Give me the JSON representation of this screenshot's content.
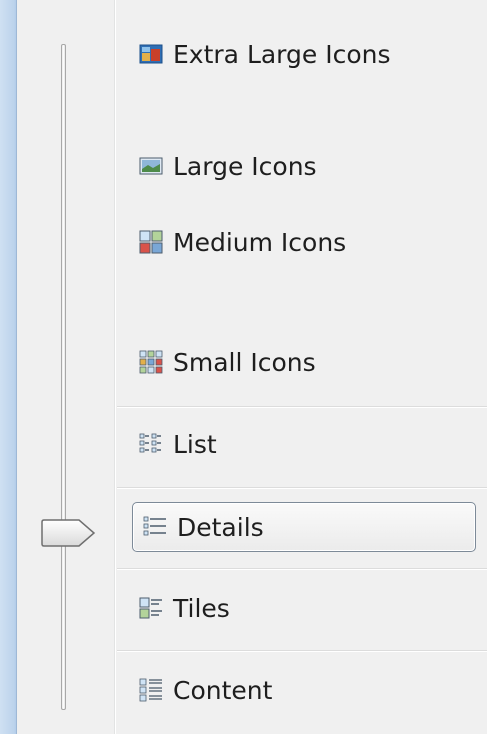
{
  "view_menu": {
    "items": [
      {
        "label": "Extra Large Icons",
        "icon": "extra-large-icons-icon"
      },
      {
        "label": "Large Icons",
        "icon": "large-icons-icon"
      },
      {
        "label": "Medium Icons",
        "icon": "medium-icons-icon"
      },
      {
        "label": "Small Icons",
        "icon": "small-icons-icon"
      },
      {
        "label": "List",
        "icon": "list-icon"
      },
      {
        "label": "Details",
        "icon": "details-icon"
      },
      {
        "label": "Tiles",
        "icon": "tiles-icon"
      },
      {
        "label": "Content",
        "icon": "content-icon"
      }
    ],
    "selected": "Details"
  }
}
